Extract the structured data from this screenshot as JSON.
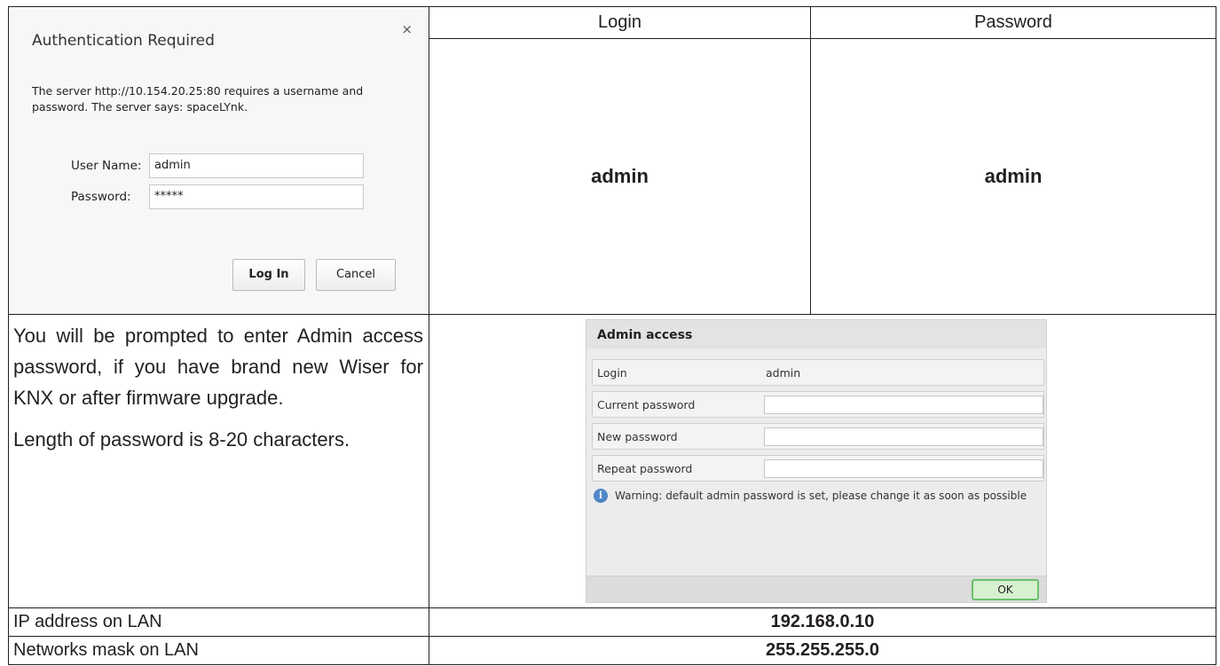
{
  "headers": {
    "login": "Login",
    "password": "Password"
  },
  "credentials": {
    "login": "admin",
    "password": "admin"
  },
  "auth_dialog": {
    "title": "Authentication Required",
    "close_glyph": "×",
    "message": "The server http://10.154.20.25:80 requires a username and password. The server says: spaceLYnk.",
    "username_label": "User Name:",
    "username_value": "admin",
    "password_label": "Password:",
    "password_value": "*****",
    "login_button": "Log In",
    "cancel_button": "Cancel"
  },
  "description": {
    "paragraph_1": "You will be prompted to enter Admin access password, if you have brand new Wiser for KNX or after firmware upgrade.",
    "paragraph_2": "Length of password is 8-20 characters."
  },
  "admin_dialog": {
    "title": "Admin access",
    "login_label": "Login",
    "login_value": "admin",
    "current_password_label": "Current password",
    "new_password_label": "New password",
    "repeat_password_label": "Repeat password",
    "warning": "Warning: default admin password is set, please change it as soon as possible",
    "ok_button": "OK",
    "info_icon": "i"
  },
  "lan": {
    "ip_label": "IP address on LAN",
    "ip_value": "192.168.0.10",
    "mask_label": "Networks mask on LAN",
    "mask_value": "255.255.255.0"
  }
}
